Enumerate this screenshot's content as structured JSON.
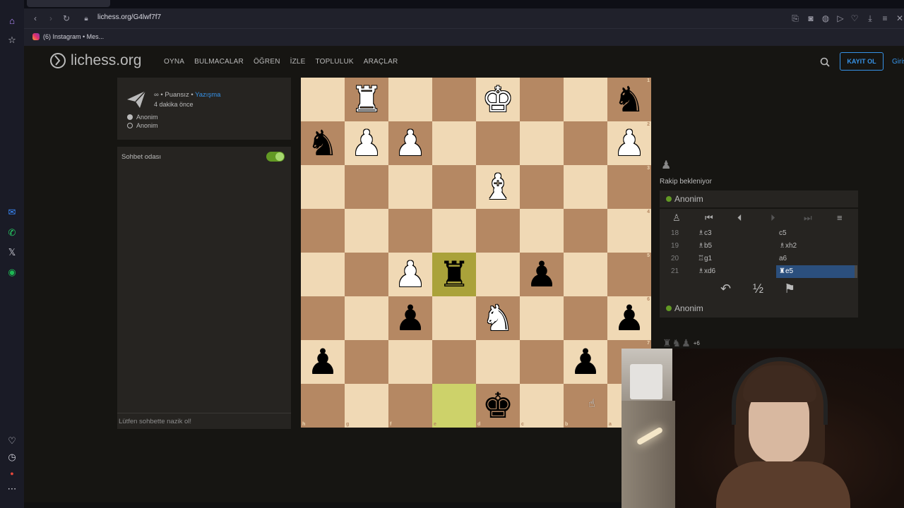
{
  "browser": {
    "url": "lichess.org/G4lwf7f7",
    "bookmark": "(6) Instagram • Mes..."
  },
  "site": {
    "logo_text": "lichess.org",
    "nav": [
      "OYNA",
      "BULMACALAR",
      "ÖĞREN",
      "İZLE",
      "TOPLULUK",
      "ARAÇLAR"
    ],
    "signup": "KAYIT OL",
    "login": "Giriş"
  },
  "game": {
    "variant_prefix": "∞ • Puansız •",
    "variant_link": "Yazışma",
    "time_ago": "4 dakika önce",
    "white_player": "Anonim",
    "black_player": "Anonim"
  },
  "chat": {
    "title": "Sohbet odası",
    "placeholder": "Lütfen sohbette nazik ol!",
    "enabled": true
  },
  "board": {
    "orientation": "black",
    "rank_labels": [
      "1",
      "2",
      "3",
      "4",
      "5",
      "6",
      "7",
      "8"
    ],
    "file_labels": [
      "h",
      "g",
      "f",
      "e",
      "d",
      "c",
      "b",
      "a"
    ],
    "rows": [
      [
        "",
        "wR",
        "",
        "",
        "wK",
        "",
        "",
        "bN"
      ],
      [
        "bN",
        "wP",
        "wP",
        "",
        "",
        "",
        "",
        "wP"
      ],
      [
        "",
        "",
        "",
        "",
        "wB",
        "",
        "",
        ""
      ],
      [
        "",
        "",
        "",
        "",
        "",
        "",
        "",
        ""
      ],
      [
        "",
        "",
        "wP",
        "bR",
        "",
        "bP",
        "",
        ""
      ],
      [
        "",
        "",
        "bP",
        "",
        "wN",
        "",
        "",
        "bP"
      ],
      [
        "bP",
        "",
        "",
        "",
        "",
        "",
        "bP",
        ""
      ],
      [
        "",
        "",
        "",
        "",
        "bK",
        "",
        "",
        ""
      ]
    ],
    "highlight": [
      [
        4,
        3
      ],
      [
        7,
        3
      ]
    ]
  },
  "panel": {
    "waiting": "Rakip bekleniyor",
    "opponent": "Anonim",
    "me": "Anonim",
    "moves": [
      {
        "n": "18",
        "w": "♗c3",
        "b": "c5"
      },
      {
        "n": "19",
        "w": "♗b5",
        "b": "♗xh2"
      },
      {
        "n": "20",
        "w": "♖g1",
        "b": "a6"
      },
      {
        "n": "21",
        "w": "♗xd6",
        "b": "♜e5"
      }
    ],
    "active_move": "21b",
    "draw_label": "½",
    "material_diff": "+6"
  }
}
